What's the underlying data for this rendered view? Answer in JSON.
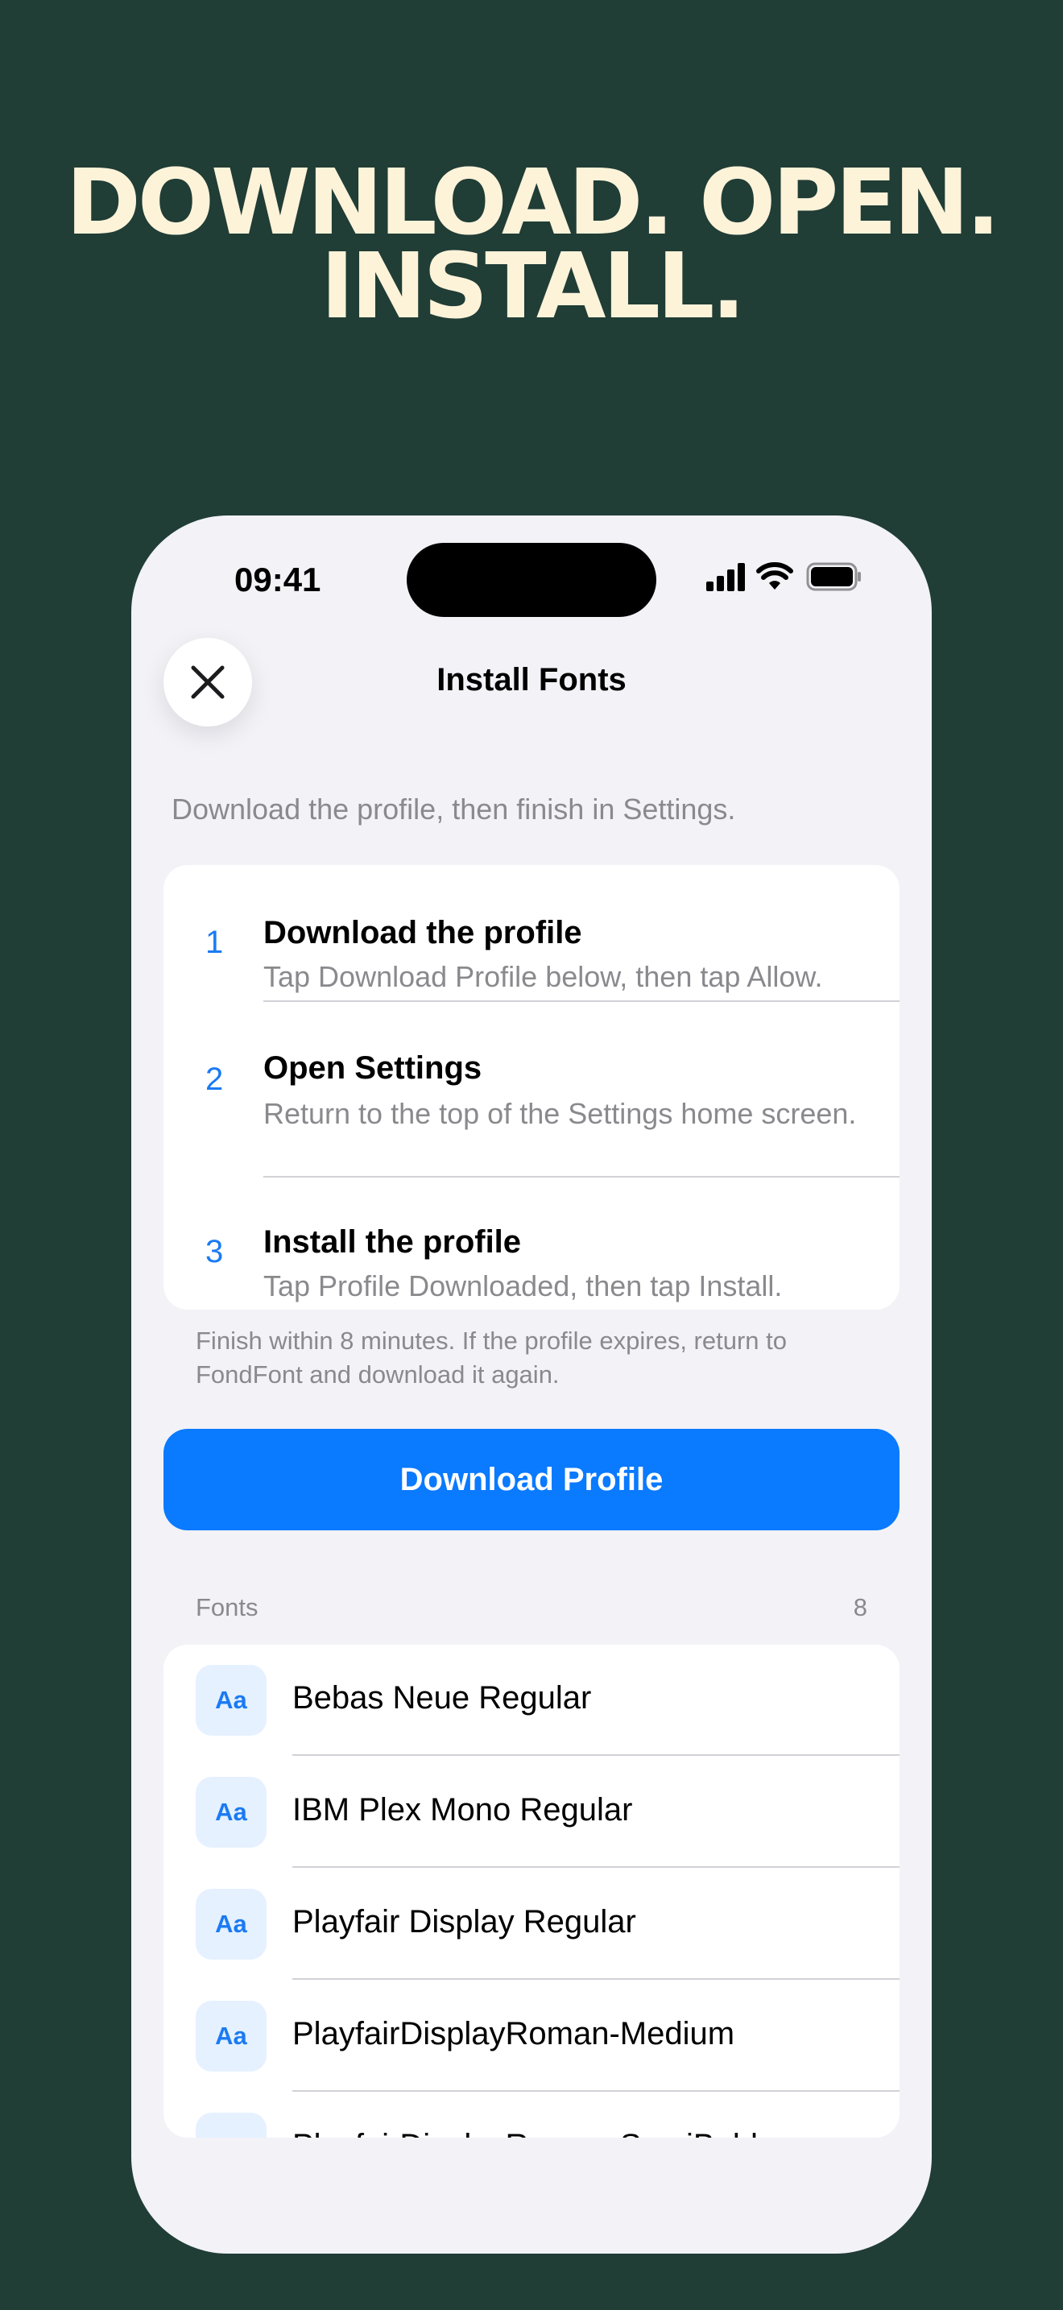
{
  "headline": {
    "line1": "DOWNLOAD. OPEN.",
    "line2": "INSTALL."
  },
  "status_bar": {
    "time": "09:41"
  },
  "nav": {
    "title": "Install Fonts",
    "close_icon": "close-icon"
  },
  "subtitle": "Download the profile, then finish in Settings.",
  "steps": [
    {
      "number": "1",
      "title": "Download the profile",
      "description": "Tap Download Profile below, then tap Allow."
    },
    {
      "number": "2",
      "title": "Open Settings",
      "description": "Return to the top of the Settings home screen."
    },
    {
      "number": "3",
      "title": "Install the profile",
      "description": "Tap Profile Downloaded, then tap Install."
    }
  ],
  "footnote": "Finish within 8 minutes. If the profile expires, return to FondFont and download it again.",
  "download_button": "Download Profile",
  "fonts_section": {
    "label": "Fonts",
    "count": "8",
    "items": [
      {
        "badge": "Aa",
        "name": "Bebas Neue Regular"
      },
      {
        "badge": "Aa",
        "name": "IBM Plex Mono Regular"
      },
      {
        "badge": "Aa",
        "name": "Playfair Display Regular"
      },
      {
        "badge": "Aa",
        "name": "PlayfairDisplayRoman-Medium"
      },
      {
        "badge": "Aa",
        "name": "PlayfairDisplayRoman-SemiBold"
      }
    ]
  },
  "colors": {
    "background": "#203d36",
    "headline": "#fdf3d9",
    "accent": "#0a7aff",
    "screen": "#f2f2f7"
  }
}
